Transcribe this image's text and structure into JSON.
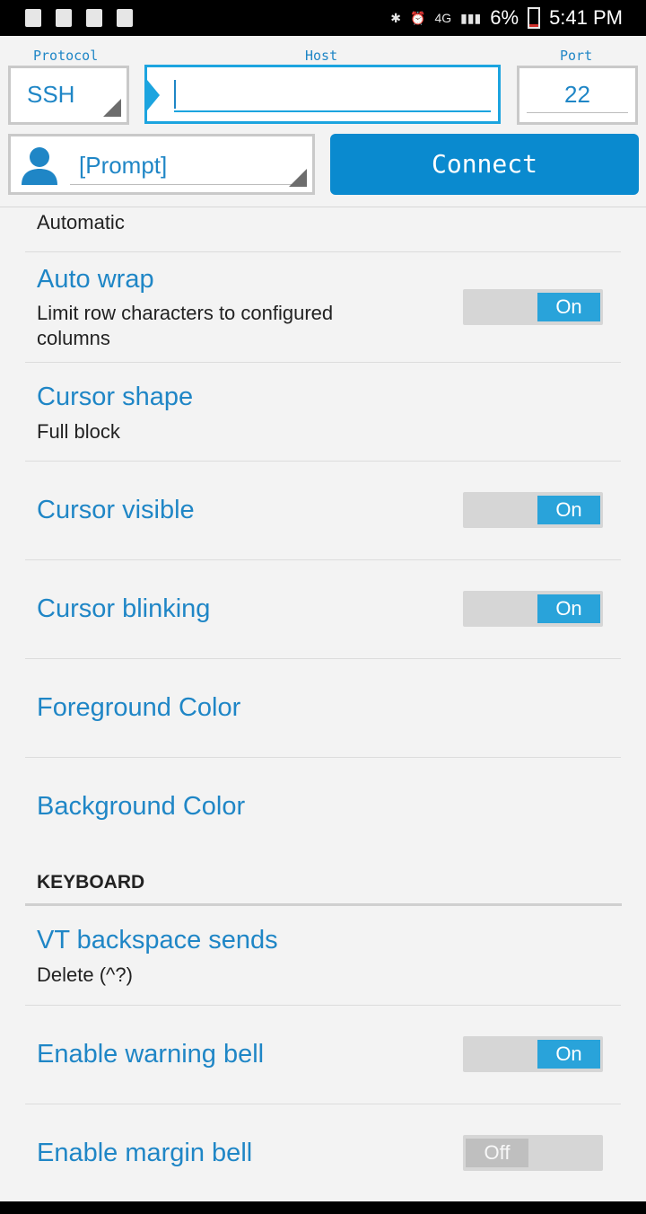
{
  "status_bar": {
    "left_icons": [
      "alert-icon",
      "download-icon",
      "activity-icon",
      "play-store-icon"
    ],
    "right_icons": [
      "bluetooth-icon",
      "alarm-icon",
      "signal-icon",
      "battery-icon"
    ],
    "network": "4G",
    "battery_percent": "6%",
    "time": "5:41 PM"
  },
  "connection": {
    "protocol_label": "Protocol",
    "protocol_value": "SSH",
    "host_label": "Host",
    "host_value": "",
    "port_label": "Port",
    "port_value": "22",
    "user_value": "[Prompt]",
    "connect_label": "Connect"
  },
  "settings": {
    "partial_top_value": "Automatic",
    "auto_wrap": {
      "title": "Auto wrap",
      "subtitle_line1": "Limit row characters to configured",
      "subtitle_line2": "columns",
      "state": "On"
    },
    "cursor_shape": {
      "title": "Cursor shape",
      "subtitle": "Full block"
    },
    "cursor_visible": {
      "title": "Cursor visible",
      "state": "On"
    },
    "cursor_blinking": {
      "title": "Cursor blinking",
      "state": "On"
    },
    "foreground_color": {
      "title": "Foreground Color"
    },
    "background_color": {
      "title": "Background Color"
    },
    "keyboard_section": "KEYBOARD",
    "vt_backspace": {
      "title": "VT backspace sends",
      "subtitle": "Delete (^?)"
    },
    "warning_bell": {
      "title": "Enable warning bell",
      "state": "On"
    },
    "margin_bell": {
      "title": "Enable margin bell",
      "state": "Off"
    }
  },
  "colors": {
    "accent": "#1f86c6",
    "connect_button": "#0a8acf",
    "switch_on": "#29a3da"
  }
}
